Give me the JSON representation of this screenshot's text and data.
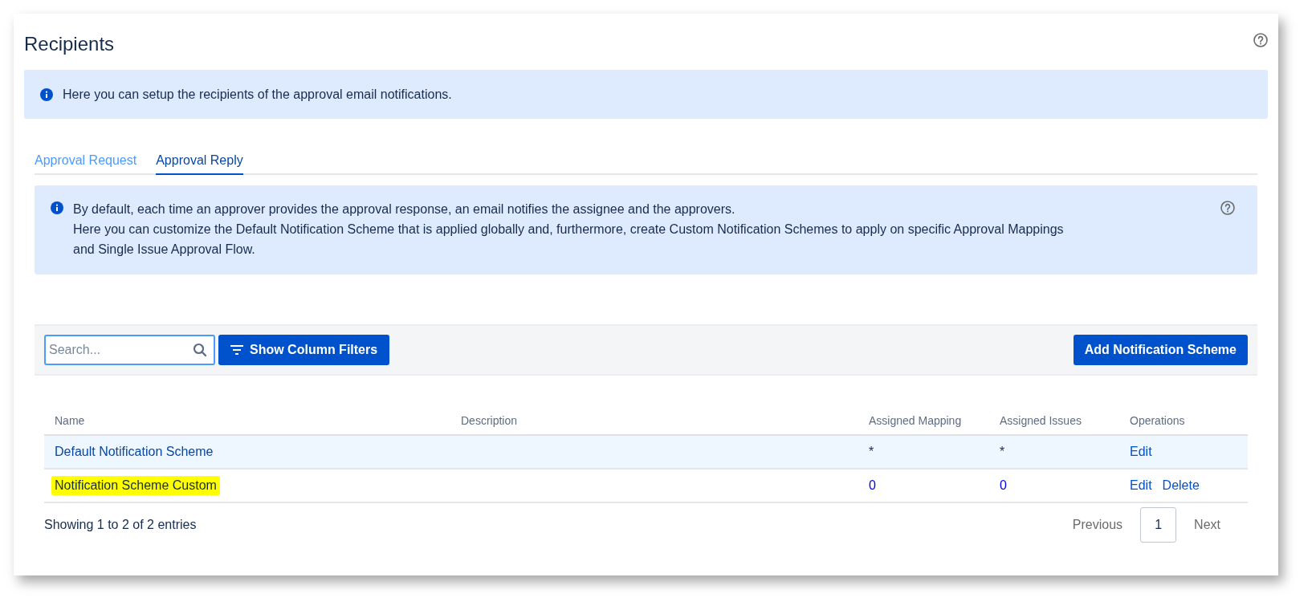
{
  "page": {
    "title": "Recipients"
  },
  "intro_banner": {
    "text": "Here you can setup the recipients of the approval email notifications."
  },
  "tabs": [
    {
      "label": "Approval Request",
      "selected": false
    },
    {
      "label": "Approval Reply",
      "selected": true
    }
  ],
  "reply_banner": {
    "lines": [
      "By default, each time an approver provides the approval response, an email notifies the assignee and the approvers.",
      "Here you can customize the Default Notification Scheme that is applied globally and, furthermore, create Custom Notification Schemes to apply on specific Approval Mappings",
      "and Single Issue Approval Flow."
    ]
  },
  "toolbar": {
    "search": {
      "placeholder": "Search..."
    },
    "filter_button": "Show Column Filters",
    "add_button": "Add Notification Scheme"
  },
  "table": {
    "columns": [
      "Name",
      "Description",
      "Assigned Mapping",
      "Assigned Issues",
      "Operations"
    ],
    "rows": [
      {
        "name": "Default Notification Scheme",
        "name_link": true,
        "marked": false,
        "shaded": true,
        "assigned_mapping": {
          "text": "*",
          "link": false
        },
        "assigned_issues": {
          "text": "*",
          "link": false
        },
        "operations": [
          "Edit"
        ]
      },
      {
        "name": "Notification Scheme Custom",
        "name_link": false,
        "marked": true,
        "shaded": false,
        "assigned_mapping": {
          "text": "0",
          "link": true
        },
        "assigned_issues": {
          "text": "0",
          "link": true
        },
        "operations": [
          "Edit",
          "Delete"
        ]
      }
    ]
  },
  "footer": {
    "info": "Showing 1 to 2 of 2 entries",
    "pagination": {
      "previous": "Previous",
      "pages": [
        {
          "label": "1",
          "selected": true
        }
      ],
      "next": "Next"
    }
  }
}
